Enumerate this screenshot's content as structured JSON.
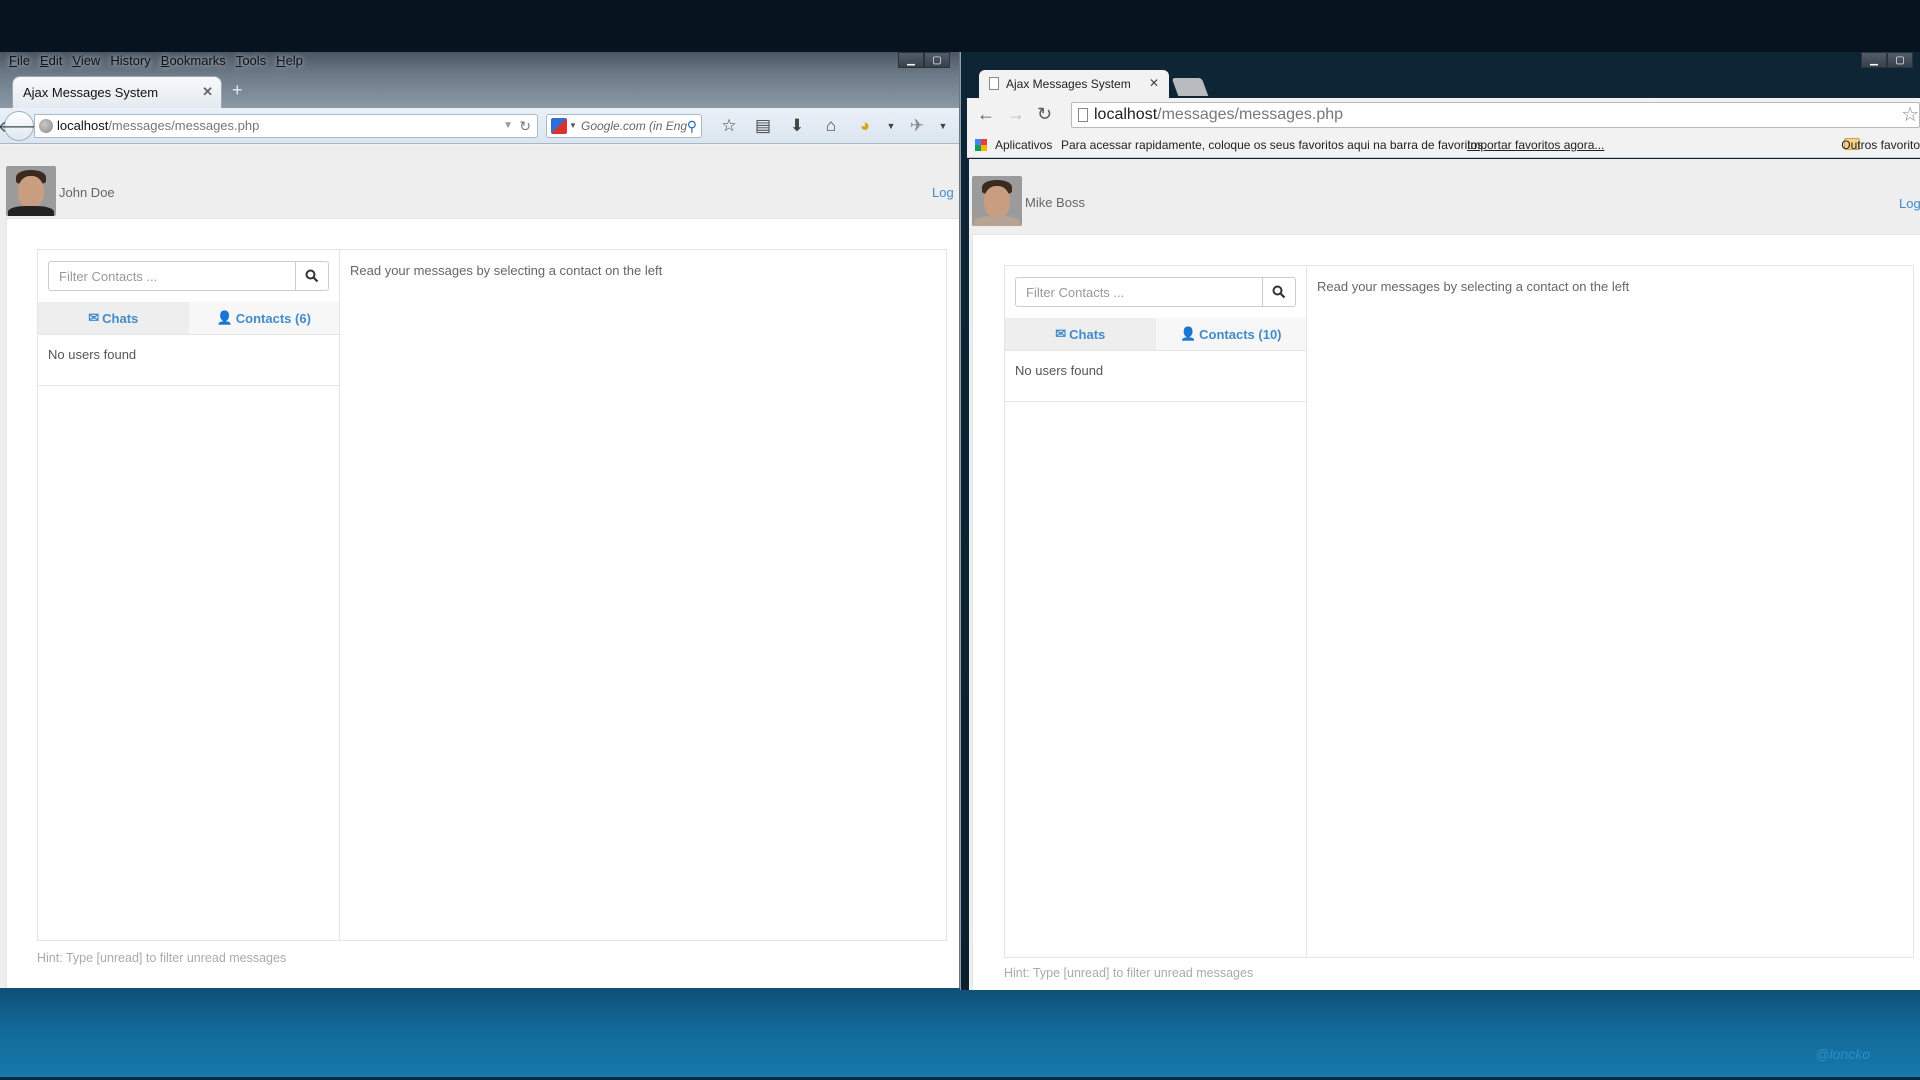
{
  "desktop": {
    "watermark": "@loncko"
  },
  "firefox": {
    "menu": [
      {
        "label": "File",
        "key": "F",
        "rest": "ile"
      },
      {
        "label": "Edit",
        "key": "E",
        "rest": "dit"
      },
      {
        "label": "View",
        "key": "V",
        "rest": "iew"
      },
      {
        "label": "History",
        "key": "",
        "rest": "History"
      },
      {
        "label": "Bookmarks",
        "key": "B",
        "rest": "ookmarks"
      },
      {
        "label": "Tools",
        "key": "T",
        "rest": "ools"
      },
      {
        "label": "Help",
        "key": "H",
        "rest": "elp"
      }
    ],
    "tab_title": "Ajax Messages System",
    "url_host": "localhost",
    "url_path": "/messages/messages.php",
    "search_placeholder": "Google.com (in Eng",
    "window_controls": {
      "minimize": "▁",
      "maximize": "▢"
    },
    "toolbar_icons": [
      "bookmark-star-icon",
      "bookmarks-list-icon",
      "downloads-icon",
      "home-icon",
      "addon-icon",
      "addon-dropdown-icon",
      "extension-icon",
      "extension-dropdown-icon"
    ],
    "page": {
      "user_name": "John Doe",
      "logout_label": "Log",
      "filter_placeholder": "Filter Contacts ...",
      "tabs": {
        "chats": "Chats",
        "contacts": "Contacts (6)"
      },
      "empty_list": "No users found",
      "read_prompt": "Read your messages by selecting a contact on the left",
      "hint": "Hint: Type [unread] to filter unread messages"
    }
  },
  "chrome": {
    "tab_title": "Ajax Messages System",
    "url_host": "localhost",
    "url_path": "/messages/messages.php",
    "bookmarks": {
      "apps_label": "Aplicativos",
      "promo": "Para acessar rapidamente, coloque os seus favoritos aqui na barra de favoritos.",
      "import_link": "Importar favoritos agora...",
      "other": "Outros favoritos"
    },
    "page": {
      "user_name": "Mike Boss",
      "logout_label": "Log",
      "filter_placeholder": "Filter Contacts ...",
      "tabs": {
        "chats": "Chats",
        "contacts": "Contacts (10)"
      },
      "empty_list": "No users found",
      "read_prompt": "Read your messages by selecting a contact on the left",
      "hint": "Hint: Type [unread] to filter unread messages"
    }
  },
  "colors": {
    "link": "#428bca",
    "page_bg": "#eeeeee",
    "hint": "#aaaaaa"
  }
}
